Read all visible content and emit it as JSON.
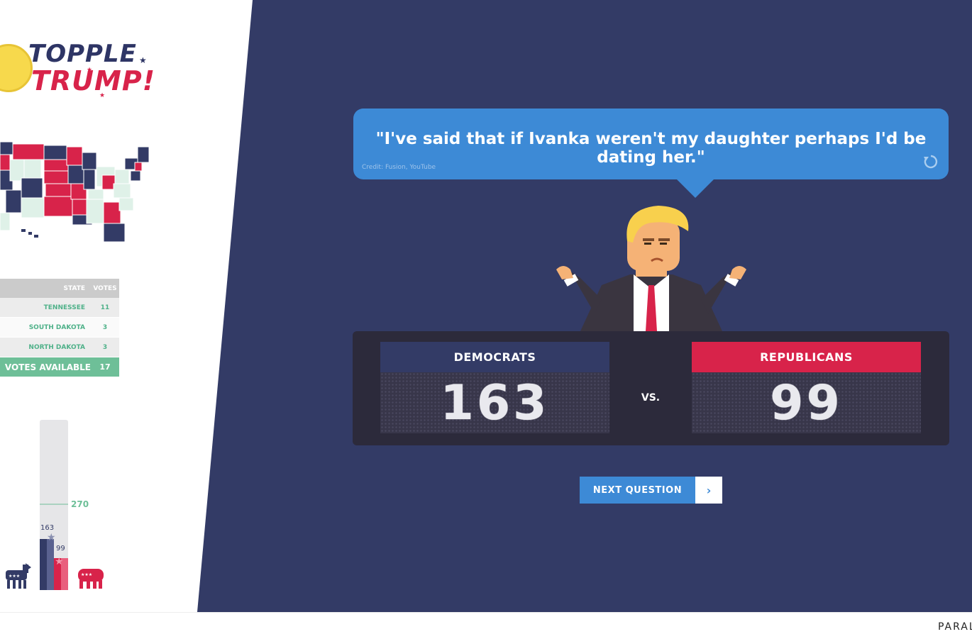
{
  "logo": {
    "line1": "TOPPLE",
    "line2": "TRUMP!"
  },
  "colors": {
    "navy": "#333b66",
    "democrat": "#333b66",
    "republican": "#d8234a",
    "accent_blue": "#3d8ad6",
    "green": "#6ebf98"
  },
  "votes_table": {
    "header": {
      "state": "STATE",
      "votes": "VOTES"
    },
    "rows": [
      {
        "state": "TENNESSEE",
        "votes": "11"
      },
      {
        "state": "SOUTH DAKOTA",
        "votes": "3"
      },
      {
        "state": "NORTH DAKOTA",
        "votes": "3"
      }
    ],
    "total": {
      "label": "VOTES AVAILABLE",
      "votes": "17"
    }
  },
  "bar_graph": {
    "target": "270",
    "dem_value": "163",
    "rep_value": "99"
  },
  "quote": {
    "text": "\"I've said that if Ivanka weren't my daughter perhaps I'd be dating her.\"",
    "credit": "Credit: Fusion, YouTube",
    "replay_icon": "replay-icon"
  },
  "scoreboard": {
    "democrats": {
      "label": "DEMOCRATS",
      "score": "163"
    },
    "republicans": {
      "label": "REPUBLICANS",
      "score": "99"
    },
    "vs": "VS."
  },
  "next_button": {
    "label": "NEXT QUESTION",
    "icon": "chevron-right-icon"
  },
  "footer": {
    "brand": "PARAL"
  }
}
